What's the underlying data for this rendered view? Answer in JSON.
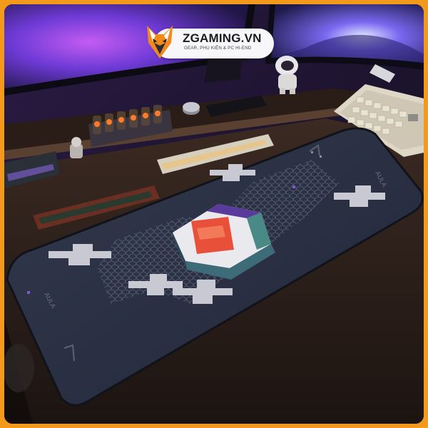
{
  "brand": {
    "name": "ZGAMING.VN",
    "tagline": "GEAR, PHỤ KIỆN & PC HI-END",
    "logo_icon": "fox-head-icon"
  },
  "photo": {
    "subject_icons": [
      "monitor-icon",
      "astronaut-figurine-icon",
      "nixie-clock-icon",
      "mechanical-keyboard-icon",
      "desk-mat-icon"
    ],
    "desk_mat_print": "AULA"
  },
  "colors": {
    "frame": "#f39a1c",
    "mat": "#2c3244",
    "monitor_glow": "#8a3fe0",
    "brand_orange": "#f08a1a"
  }
}
